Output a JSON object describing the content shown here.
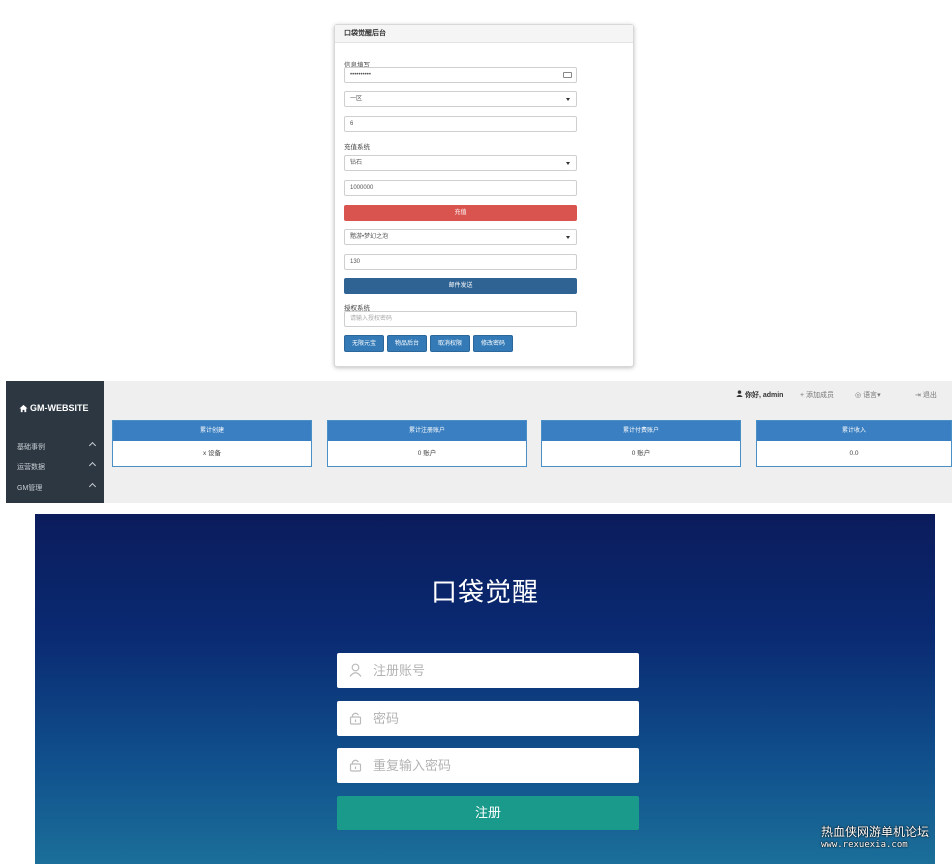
{
  "gm_panel": {
    "title": "口袋觉醒后台",
    "info_label": "信息填写",
    "password_value": "••••••••••",
    "server_select": "一区",
    "role_value": "6",
    "recharge_label": "充值系统",
    "currency_select": "钻石",
    "amount_value": "1000000",
    "recharge_button": "充值",
    "item_select": "黯游•梦幻之泡",
    "item_qty_value": "130",
    "mail_button": "邮件发送",
    "auth_label": "授权系统",
    "auth_placeholder": "请输入授权密码",
    "buttons": [
      "无限元宝",
      "物品后台",
      "取消权限",
      "修改密码"
    ]
  },
  "dashboard": {
    "brand": "GM-WEBSITE",
    "sidebar": [
      {
        "label": "基础事例"
      },
      {
        "label": "运营数据"
      },
      {
        "label": "GM管理"
      }
    ],
    "topbar": {
      "user": "你好, admin",
      "add_member": "添加成员",
      "language": "语言",
      "logout": "退出"
    },
    "cards": [
      {
        "title": "累计创建",
        "value": "x 设备"
      },
      {
        "title": "累计注册账户",
        "value": "0 账户"
      },
      {
        "title": "累计付费账户",
        "value": "0 账户"
      },
      {
        "title": "累计收入",
        "value": "0.0"
      }
    ]
  },
  "register": {
    "title": "口袋觉醒",
    "account_placeholder": "注册账号",
    "password_placeholder": "密码",
    "repeat_placeholder": "重复输入密码",
    "submit": "注册"
  },
  "watermark": {
    "text": "热血侠网游单机论坛",
    "url": "www.rexuexia.com"
  }
}
